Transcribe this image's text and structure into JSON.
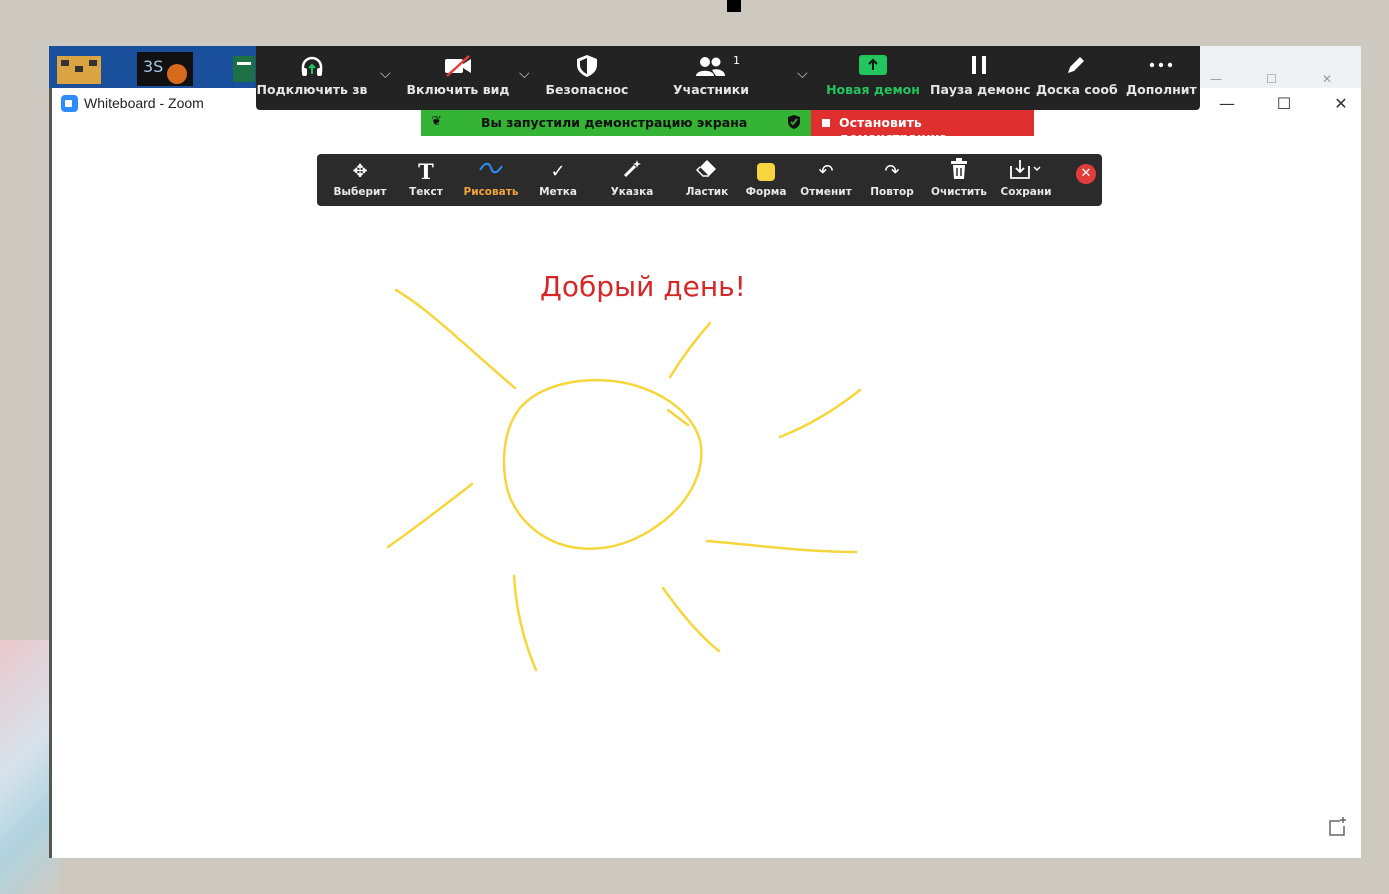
{
  "window": {
    "title": "Whiteboard - Zoom",
    "minimize": "—",
    "maximize": "☐",
    "close": "✕"
  },
  "meeting_controls": {
    "audio": "Подключить зв",
    "video": "Включить вид",
    "security": "Безопаснос",
    "participants": "Участники",
    "participants_count": "1",
    "new_share": "Новая демон",
    "pause_share": "Пауза демонс",
    "whiteboard": "Доска сооб",
    "more": "Дополнит",
    "new_share_color": "#22c55e"
  },
  "share_banner": {
    "message": "Вы запустили демонстрацию экрана",
    "stop_label": "Остановить демонстрацию"
  },
  "annotation_tools": [
    {
      "label": "Выберит",
      "icon": "move-icon"
    },
    {
      "label": "Текст",
      "icon": "text-icon"
    },
    {
      "label": "Рисовать",
      "icon": "draw-icon",
      "active": true
    },
    {
      "label": "Метка",
      "icon": "checkmark-icon"
    },
    {
      "label": "Указка",
      "icon": "spotlight-icon"
    },
    {
      "label": "Ластик",
      "icon": "eraser-icon"
    },
    {
      "label": "Форма",
      "icon": "format-swatch-icon"
    },
    {
      "label": "Отменит",
      "icon": "undo-icon"
    },
    {
      "label": "Повтор",
      "icon": "redo-icon"
    },
    {
      "label": "Очистить",
      "icon": "trash-icon"
    },
    {
      "label": "Сохрани",
      "icon": "save-icon"
    }
  ],
  "canvas": {
    "greeting": "Добрый день!",
    "pen_color": "#f5d63d",
    "text_color": "#d52828"
  }
}
